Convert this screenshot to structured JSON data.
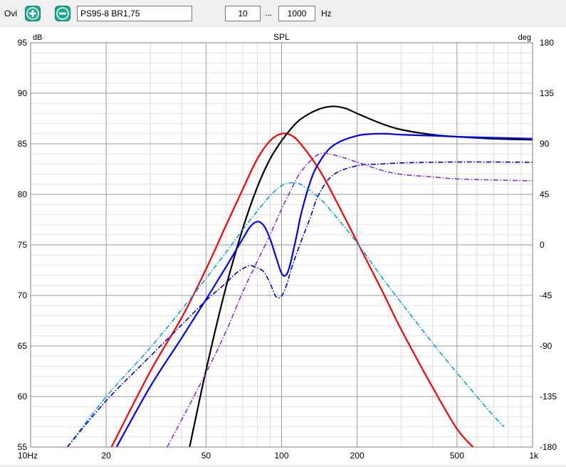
{
  "toolbar": {
    "label": "Ovl",
    "project_name": "PS95-8 BR1,75",
    "freq_from": "10",
    "freq_separator": "...",
    "freq_to": "1000",
    "freq_unit": "Hz"
  },
  "chart_data": {
    "type": "line",
    "title": "SPL",
    "left_axis_label": "dB",
    "right_axis_label": "deg",
    "x_scale": "log",
    "xlim": [
      10,
      1000
    ],
    "ylim": [
      55,
      95
    ],
    "y2lim": [
      -180,
      180
    ],
    "x_ticks": [
      10,
      20,
      50,
      100,
      200,
      500,
      1000
    ],
    "x_tick_labels": [
      "10Hz",
      "20",
      "50",
      "100",
      "200",
      "500",
      "1k"
    ],
    "y_ticks": [
      55,
      60,
      65,
      70,
      75,
      80,
      85,
      90,
      95
    ],
    "y2_ticks": [
      -180,
      -135,
      -90,
      -45,
      0,
      45,
      90,
      135,
      180
    ],
    "grid": true,
    "series": [
      {
        "color": "#ff0000",
        "style": "solid",
        "axis": "left",
        "x": [
          21,
          30,
          40,
          50,
          60,
          70,
          80,
          90,
          100,
          110,
          120,
          140,
          160,
          200,
          250,
          300,
          400,
          500,
          590
        ],
        "y": [
          55,
          62.5,
          67.8,
          72.6,
          76.9,
          80.5,
          83.5,
          85.3,
          86.0,
          85.8,
          84.9,
          82.6,
          80.0,
          75.3,
          70.6,
          66.6,
          60.9,
          56.8,
          54.8
        ]
      },
      {
        "color": "#000000",
        "style": "solid",
        "axis": "left",
        "x": [
          43,
          50,
          60,
          70,
          80,
          90,
          100,
          110,
          120,
          140,
          160,
          180,
          200,
          250,
          300,
          400,
          500,
          700,
          1000
        ],
        "y": [
          55,
          62.6,
          70.8,
          76.6,
          80.7,
          83.5,
          85.3,
          86.6,
          87.5,
          88.4,
          88.7,
          88.5,
          88.0,
          87.0,
          86.4,
          85.9,
          85.7,
          85.5,
          85.4
        ]
      },
      {
        "color": "#0000ff",
        "style": "solid",
        "axis": "left",
        "x": [
          22,
          30,
          40,
          50,
          60,
          70,
          75,
          80,
          85,
          90,
          95,
          100,
          104,
          108,
          115,
          120,
          130,
          140,
          160,
          200,
          250,
          300,
          400,
          500,
          700,
          1000
        ],
        "y": [
          55,
          61.0,
          65.8,
          69.6,
          72.8,
          75.6,
          76.8,
          77.3,
          76.9,
          75.6,
          73.8,
          72.2,
          72.0,
          73.0,
          76.0,
          78.2,
          81.2,
          83.0,
          84.8,
          85.8,
          86.0,
          85.9,
          85.8,
          85.7,
          85.6,
          85.5
        ]
      },
      {
        "color": "#00a2e8",
        "style": "dashdot",
        "axis": "right",
        "x": [
          14,
          20,
          30,
          40,
          50,
          60,
          70,
          80,
          90,
          100,
          110,
          120,
          140,
          160,
          200,
          250,
          300,
          400,
          500,
          600,
          700,
          770
        ],
        "y": [
          -180,
          -135.2,
          -91.5,
          -57.5,
          -29.9,
          -6.7,
          13.5,
          30.0,
          43.8,
          52.8,
          55.3,
          53.5,
          42.5,
          28.5,
          1.8,
          -28.3,
          -51.6,
          -87.5,
          -114.0,
          -135.0,
          -152.4,
          -162.0
        ]
      },
      {
        "color": "#0000cd",
        "style": "dashdot",
        "axis": "right",
        "x": [
          14,
          20,
          30,
          40,
          50,
          60,
          65,
          70,
          75,
          80,
          85,
          90,
          95,
          100,
          105,
          110,
          120,
          130,
          140,
          160,
          200,
          250,
          300,
          400,
          500,
          700,
          1000
        ],
        "y": [
          -180,
          -138.8,
          -99.0,
          -71.2,
          -49.5,
          -34.0,
          -26.3,
          -21.2,
          -18.5,
          -20.5,
          -24.0,
          -34.2,
          -46.0,
          -45.5,
          -35.0,
          -19.5,
          4.0,
          24.0,
          43.8,
          62.0,
          70.5,
          72.0,
          73.0,
          73.5,
          73.8,
          73.8,
          73.5
        ]
      },
      {
        "color": "#8a2be2",
        "style": "dashdot",
        "axis": "right",
        "x": [
          35,
          40,
          50,
          60,
          70,
          80,
          90,
          100,
          110,
          120,
          140,
          160,
          200,
          250,
          300,
          400,
          500,
          700,
          1000
        ],
        "y": [
          -180,
          -155.6,
          -114.0,
          -77.3,
          -42.0,
          -14.7,
          9.0,
          31.9,
          50.7,
          65.7,
          80.5,
          80.3,
          73.7,
          66.5,
          62.8,
          60.5,
          58.7,
          57.8,
          57.0
        ]
      }
    ]
  }
}
